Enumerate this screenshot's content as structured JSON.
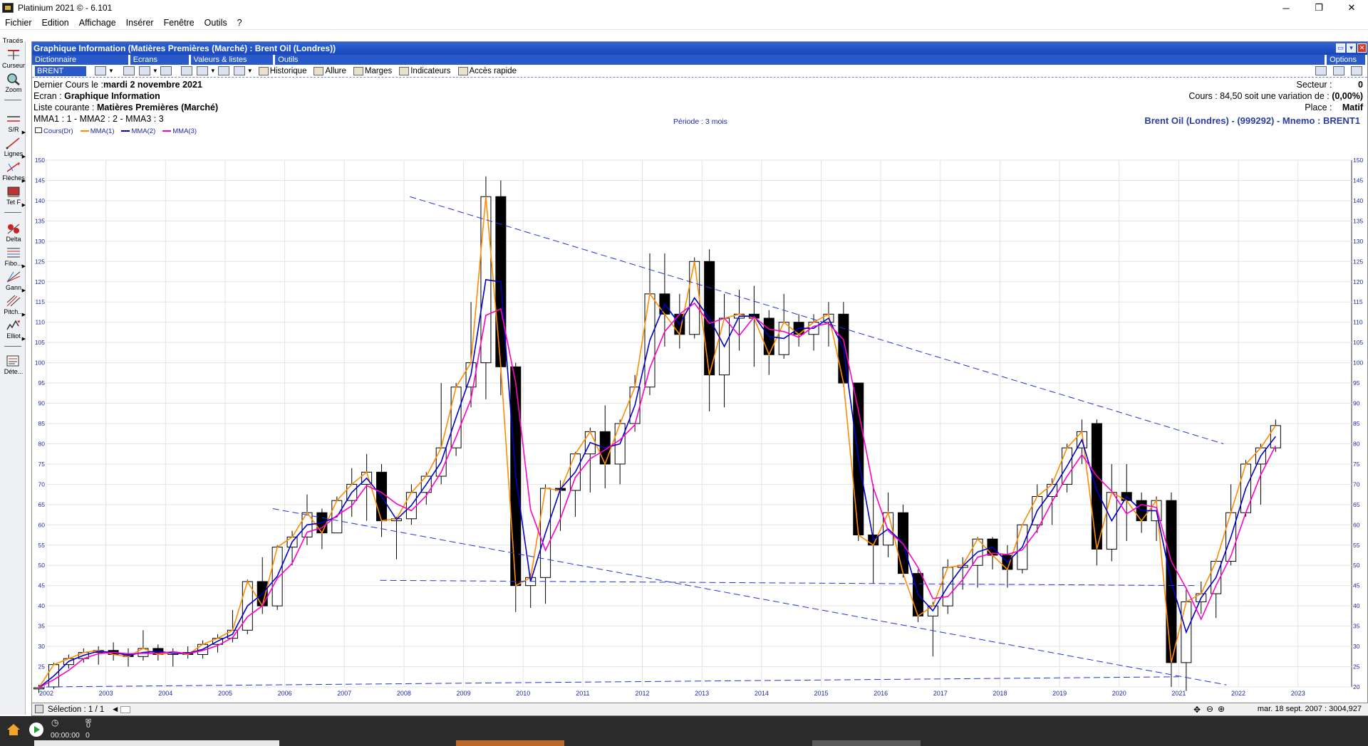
{
  "app": {
    "title": "Platinium 2021 © - 6.101",
    "window_buttons": [
      "─",
      "❐",
      "✕"
    ]
  },
  "menu": [
    "Fichier",
    "Edition",
    "Affichage",
    "Insérer",
    "Fenêtre",
    "Outils",
    "?"
  ],
  "left_tools": [
    {
      "label": "Tracés",
      "icon": "traces-icon"
    },
    {
      "label": "Curseur",
      "icon": "cursor-icon"
    },
    {
      "label": "Zoom",
      "icon": "zoom-icon"
    },
    {
      "label": "S/R",
      "icon": "support-resistance-icon"
    },
    {
      "label": "Lignes",
      "icon": "lines-icon"
    },
    {
      "label": "Flèches",
      "icon": "arrows-icon"
    },
    {
      "label": "Tet F",
      "icon": "tet-f-icon"
    },
    {
      "label": "Delta",
      "icon": "delta-icon"
    },
    {
      "label": "Fibo...",
      "icon": "fibonacci-icon"
    },
    {
      "label": "Gann",
      "icon": "gann-icon"
    },
    {
      "label": "Pitch...",
      "icon": "pitchfork-icon"
    },
    {
      "label": "Elliot",
      "icon": "elliott-icon"
    },
    {
      "label": "Déte...",
      "icon": "detection-icon"
    }
  ],
  "window": {
    "title": "Graphique Information (Matières Premières (Marché) : Brent Oil (Londres))",
    "sections": [
      "Dictionnaire",
      "Ecrans",
      "Valeurs & listes",
      "Outils"
    ],
    "options_label": "Options",
    "ticker": "BRENT",
    "tools": [
      "Historique",
      "Allure",
      "Marges",
      "Indicateurs",
      "Accès rapide"
    ]
  },
  "info": {
    "last_label": "Dernier Cours le :",
    "last_date": "mardi 2 novembre 2021",
    "screen_label": "Ecran :",
    "screen_value": "Graphique Information",
    "list_label": "Liste courante :",
    "list_value": "Matières Premières (Marché)",
    "mma_line": "MMA1 : 1 - MMA2 : 2 - MMA3 : 3",
    "period": "Période : 3 mois",
    "sector_label": "Secteur :",
    "sector_value": "0",
    "cours_label": "Cours : 84,50 soit une variation de :",
    "cours_var": "(0,00%)",
    "place_label": "Place :",
    "place_value": "Matif",
    "instrument": "Brent Oil (Londres) - (999292) - Mnemo : BRENT1"
  },
  "legend": [
    "Cours(Dr)",
    "MMA(1)",
    "MMA(2)",
    "MMA(3)"
  ],
  "colors": {
    "mma1": "#ff8c00",
    "mma2": "#0000cc",
    "mma3": "#ff00cc",
    "trend": "#2233dd",
    "candle": "#000000",
    "accent": "#2a59c9"
  },
  "footer": {
    "selection": "Sélection : 1 / 1",
    "cursor_readout": "mar. 18 sept. 2007 : 3004,927"
  },
  "taskbar": {
    "timer": "00:00:00",
    "count": "0",
    "count2": "0"
  },
  "chart_data": {
    "type": "candlestick",
    "title": "",
    "ylim": [
      20,
      150
    ],
    "yticks": [
      20,
      25,
      30,
      35,
      40,
      45,
      50,
      55,
      60,
      65,
      70,
      75,
      80,
      85,
      90,
      95,
      100,
      105,
      110,
      115,
      120,
      125,
      130,
      135,
      140,
      145,
      150
    ],
    "xlim": [
      2002.0,
      2023.9
    ],
    "xticks": [
      "2002",
      "2003",
      "2004",
      "2005",
      "2006",
      "2007",
      "2008",
      "2009",
      "2010",
      "2011",
      "2012",
      "2013",
      "2014",
      "2015",
      "2016",
      "2017",
      "2018",
      "2019",
      "2020",
      "2021",
      "2022",
      "2023"
    ],
    "grid": true,
    "period": "3 mois",
    "candles_ohlc": [
      [
        19.5,
        20.5,
        18.5,
        19.8
      ],
      [
        20.0,
        26.0,
        19.5,
        25.5
      ],
      [
        25.5,
        28.0,
        24.5,
        27.0
      ],
      [
        27.0,
        29.5,
        26.0,
        28.5
      ],
      [
        28.5,
        30.0,
        25.5,
        29.0
      ],
      [
        29.0,
        31.0,
        26.5,
        28.0
      ],
      [
        28.0,
        29.5,
        25.0,
        27.5
      ],
      [
        27.5,
        34.0,
        26.5,
        29.5
      ],
      [
        29.5,
        30.5,
        26.5,
        28.0
      ],
      [
        28.0,
        29.5,
        25.0,
        28.5
      ],
      [
        28.5,
        30.0,
        27.0,
        28.0
      ],
      [
        28.0,
        31.5,
        27.0,
        30.5
      ],
      [
        30.5,
        33.0,
        28.5,
        32.0
      ],
      [
        32.0,
        39.0,
        31.0,
        34.0
      ],
      [
        34.0,
        46.5,
        33.0,
        46.0
      ],
      [
        46.0,
        52.0,
        38.0,
        40.0
      ],
      [
        40.0,
        55.0,
        39.0,
        54.5
      ],
      [
        54.5,
        58.5,
        50.0,
        57.0
      ],
      [
        57.0,
        67.5,
        55.0,
        63.0
      ],
      [
        63.0,
        64.0,
        54.0,
        58.0
      ],
      [
        58.0,
        67.0,
        58.0,
        66.0
      ],
      [
        66.0,
        74.0,
        62.0,
        70.0
      ],
      [
        70.0,
        77.5,
        61.0,
        73.0
      ],
      [
        73.0,
        75.0,
        57.0,
        61.0
      ],
      [
        61.0,
        62.0,
        51.5,
        61.5
      ],
      [
        61.5,
        70.0,
        60.0,
        68.0
      ],
      [
        68.0,
        73.0,
        65.0,
        72.0
      ],
      [
        72.0,
        95.0,
        70.0,
        79.0
      ],
      [
        79.0,
        95.0,
        77.0,
        94.0
      ],
      [
        94.0,
        115.0,
        89.0,
        100.0
      ],
      [
        100.0,
        146.0,
        91.0,
        141.0
      ],
      [
        141.0,
        145.0,
        92.0,
        99.0
      ],
      [
        99.0,
        100.0,
        38.5,
        45.0
      ],
      [
        45.0,
        48.0,
        39.5,
        47.0
      ],
      [
        47.0,
        70.0,
        40.5,
        69.0
      ],
      [
        69.0,
        71.0,
        58.5,
        68.5
      ],
      [
        68.5,
        78.0,
        62.0,
        77.5
      ],
      [
        77.5,
        84.0,
        68.0,
        83.0
      ],
      [
        83.0,
        89.5,
        69.0,
        75.0
      ],
      [
        75.0,
        86.0,
        70.0,
        85.0
      ],
      [
        85.0,
        97.0,
        83.0,
        94.0
      ],
      [
        94.0,
        127.0,
        92.0,
        117.0
      ],
      [
        117.0,
        127.0,
        104.0,
        112.0
      ],
      [
        112.0,
        117.0,
        103.5,
        107.0
      ],
      [
        107.0,
        126.0,
        106.0,
        125.0
      ],
      [
        125.0,
        128.0,
        88.0,
        97.0
      ],
      [
        97.0,
        117.0,
        89.0,
        111.0
      ],
      [
        111.0,
        118.0,
        103.0,
        112.0
      ],
      [
        112.0,
        119.0,
        99.0,
        111.0
      ],
      [
        111.0,
        113.0,
        97.0,
        102.0
      ],
      [
        102.0,
        117.0,
        101.0,
        110.0
      ],
      [
        110.0,
        112.0,
        104.0,
        107.0
      ],
      [
        107.0,
        112.0,
        103.0,
        110.0
      ],
      [
        110.0,
        115.0,
        104.0,
        112.0
      ],
      [
        112.0,
        115.0,
        94.0,
        95.0
      ],
      [
        95.0,
        95.0,
        56.0,
        57.5
      ],
      [
        57.5,
        70.0,
        45.5,
        55.0
      ],
      [
        55.0,
        68.0,
        52.0,
        63.0
      ],
      [
        63.0,
        65.0,
        47.0,
        48.0
      ],
      [
        48.0,
        49.0,
        36.0,
        37.5
      ],
      [
        37.5,
        41.0,
        27.5,
        40.0
      ],
      [
        40.0,
        51.5,
        38.0,
        49.5
      ],
      [
        49.5,
        52.0,
        44.0,
        50.0
      ],
      [
        50.0,
        57.0,
        44.5,
        56.5
      ],
      [
        56.5,
        57.0,
        49.0,
        52.5
      ],
      [
        52.5,
        55.0,
        44.5,
        49.0
      ],
      [
        49.0,
        58.0,
        48.0,
        60.0
      ],
      [
        60.0,
        70.0,
        58.0,
        67.0
      ],
      [
        67.0,
        71.5,
        60.0,
        70.0
      ],
      [
        70.0,
        80.0,
        68.0,
        79.0
      ],
      [
        79.0,
        86.0,
        75.0,
        83.0
      ],
      [
        85.0,
        86.0,
        50.0,
        54.0
      ],
      [
        54.0,
        75.0,
        51.0,
        68.0
      ],
      [
        68.0,
        75.0,
        56.0,
        66.0
      ],
      [
        66.0,
        68.0,
        58.0,
        61.0
      ],
      [
        61.0,
        67.0,
        56.0,
        66.0
      ],
      [
        66.0,
        68.0,
        20.0,
        26.0
      ],
      [
        26.0,
        44.0,
        19.0,
        41.0
      ],
      [
        41.0,
        46.0,
        38.0,
        43.0
      ],
      [
        43.0,
        51.5,
        37.0,
        51.0
      ],
      [
        51.0,
        70.0,
        50.0,
        63.0
      ],
      [
        63.0,
        76.0,
        62.0,
        75.0
      ],
      [
        75.0,
        80.0,
        65.0,
        79.0
      ],
      [
        79.0,
        86.0,
        78.0,
        84.5
      ]
    ],
    "series": [
      {
        "name": "MMA(1)",
        "values": [
          19.8,
          25.5,
          27.0,
          28.5,
          29.0,
          28.0,
          27.5,
          29.5,
          28.0,
          28.5,
          28.0,
          30.5,
          32.0,
          34.0,
          46.0,
          40.0,
          54.5,
          57.0,
          63.0,
          58.0,
          66.0,
          70.0,
          73.0,
          61.0,
          61.5,
          68.0,
          72.0,
          79.0,
          94.0,
          100.0,
          141.0,
          99.0,
          45.0,
          47.0,
          69.0,
          68.5,
          77.5,
          83.0,
          75.0,
          85.0,
          94.0,
          117.0,
          112.0,
          107.0,
          125.0,
          97.0,
          111.0,
          112.0,
          111.0,
          102.0,
          110.0,
          107.0,
          110.0,
          112.0,
          95.0,
          57.5,
          55.0,
          63.0,
          48.0,
          37.5,
          40.0,
          49.5,
          50.0,
          56.5,
          52.5,
          49.0,
          60.0,
          67.0,
          70.0,
          79.0,
          83.0,
          54.0,
          68.0,
          66.0,
          61.0,
          66.0,
          26.0,
          41.0,
          43.0,
          51.0,
          63.0,
          75.0,
          79.0,
          84.5
        ]
      },
      {
        "name": "MMA(2)",
        "values": [
          19.8,
          22.7,
          26.3,
          27.8,
          28.8,
          28.5,
          27.8,
          28.5,
          28.8,
          28.3,
          28.3,
          29.3,
          31.3,
          33.0,
          40.0,
          43.0,
          47.3,
          55.8,
          60.0,
          60.5,
          62.0,
          68.0,
          71.5,
          67.0,
          61.3,
          64.8,
          70.0,
          75.5,
          86.5,
          97.0,
          120.5,
          120.0,
          72.0,
          46.0,
          58.0,
          68.8,
          73.0,
          80.3,
          79.0,
          80.0,
          89.5,
          105.5,
          114.5,
          109.5,
          116.0,
          111.0,
          104.0,
          111.5,
          111.5,
          106.5,
          106.0,
          108.5,
          108.5,
          111.0,
          103.5,
          76.3,
          56.3,
          59.0,
          55.5,
          42.8,
          38.8,
          44.8,
          49.8,
          53.3,
          54.5,
          50.8,
          54.5,
          63.5,
          68.5,
          74.5,
          81.0,
          68.5,
          61.0,
          67.0,
          63.5,
          63.5,
          46.0,
          33.5,
          42.0,
          47.0,
          57.0,
          69.0,
          77.0,
          81.8
        ]
      },
      {
        "name": "MMA(3)",
        "values": [
          19.8,
          21.8,
          24.1,
          27.0,
          28.2,
          28.5,
          28.2,
          28.3,
          28.3,
          28.7,
          28.2,
          29.0,
          30.2,
          32.2,
          37.3,
          40.0,
          46.8,
          50.5,
          58.2,
          59.3,
          62.3,
          64.7,
          69.7,
          68.0,
          65.2,
          63.5,
          67.2,
          73.0,
          81.7,
          91.0,
          111.7,
          113.3,
          95.0,
          63.7,
          53.7,
          61.5,
          71.7,
          76.3,
          78.5,
          81.0,
          84.7,
          98.7,
          107.7,
          112.0,
          114.7,
          109.7,
          111.0,
          106.7,
          111.3,
          108.3,
          107.7,
          106.3,
          109.0,
          109.7,
          105.7,
          88.2,
          69.2,
          58.5,
          55.3,
          49.5,
          41.8,
          42.3,
          46.5,
          52.0,
          53.0,
          52.7,
          53.8,
          58.7,
          65.7,
          72.0,
          77.3,
          72.0,
          68.3,
          62.7,
          65.0,
          64.3,
          51.0,
          44.3,
          36.7,
          45.0,
          52.3,
          63.0,
          72.3,
          79.5
        ]
      }
    ],
    "trendlines": [
      {
        "style": "dashed",
        "from": [
          2008.1,
          141.0
        ],
        "to": [
          2021.75,
          80.0
        ]
      },
      {
        "style": "dashed",
        "from": [
          2005.8,
          64.0
        ],
        "to": [
          2021.8,
          20.5
        ]
      },
      {
        "style": "dashed",
        "from": [
          2007.6,
          46.3
        ],
        "to": [
          2021.3,
          45.0
        ]
      },
      {
        "style": "dashed",
        "from": [
          2002.0,
          20.0
        ],
        "to": [
          2021.0,
          22.5
        ]
      }
    ]
  }
}
